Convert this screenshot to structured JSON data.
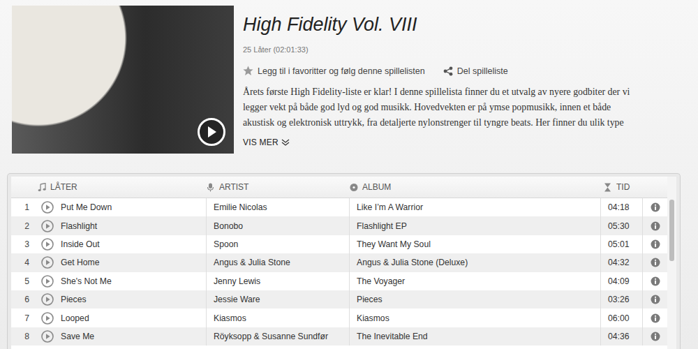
{
  "playlist": {
    "title": "High Fidelity Vol. VIII",
    "count": "25 Låter (02:01:33)",
    "favorite": "Legg til i favoritter og følg denne spillelisten",
    "share": "Del spilleliste",
    "description": [
      "Årets første High Fidelity-liste er klar! I denne spillelista finner du et utvalg av nyere godbiter der vi",
      "legger vekt på både god lyd og god musikk. Hovedvekten er på ymse popmusikk, innen et både",
      "akustisk og elektronisk uttrykk, fra detaljerte nylonstrenger til tyngre beats. Her finner du ulik type"
    ],
    "more": "VIS MER"
  },
  "table": {
    "columns": [
      "LÅTER",
      "ARTIST",
      "ALBUM",
      "TID"
    ],
    "rows": [
      {
        "number": "1",
        "title": "Put Me Down",
        "artist": "Emilie Nicolas",
        "album": "Like I’m A Warrior",
        "time": "04:18"
      },
      {
        "number": "2",
        "title": "Flashlight",
        "artist": "Bonobo",
        "album": "Flashlight EP",
        "time": "05:30"
      },
      {
        "number": "3",
        "title": "Inside Out",
        "artist": "Spoon",
        "album": "They Want My Soul",
        "time": "05:01"
      },
      {
        "number": "4",
        "title": "Get Home",
        "artist": "Angus & Julia Stone",
        "album": "Angus & Julia Stone (Deluxe)",
        "time": "04:32"
      },
      {
        "number": "5",
        "title": "She's Not Me",
        "artist": "Jenny Lewis",
        "album": "The Voyager",
        "time": "04:09"
      },
      {
        "number": "6",
        "title": "Pieces",
        "artist": "Jessie Ware",
        "album": "Pieces",
        "time": "03:26"
      },
      {
        "number": "7",
        "title": "Looped",
        "artist": "Kiasmos",
        "album": "Kiasmos",
        "time": "06:00"
      },
      {
        "number": "8",
        "title": "Save Me",
        "artist": "Röyksopp & Susanne Sundfør",
        "album": "The Inevitable End",
        "time": "04:36"
      }
    ]
  }
}
